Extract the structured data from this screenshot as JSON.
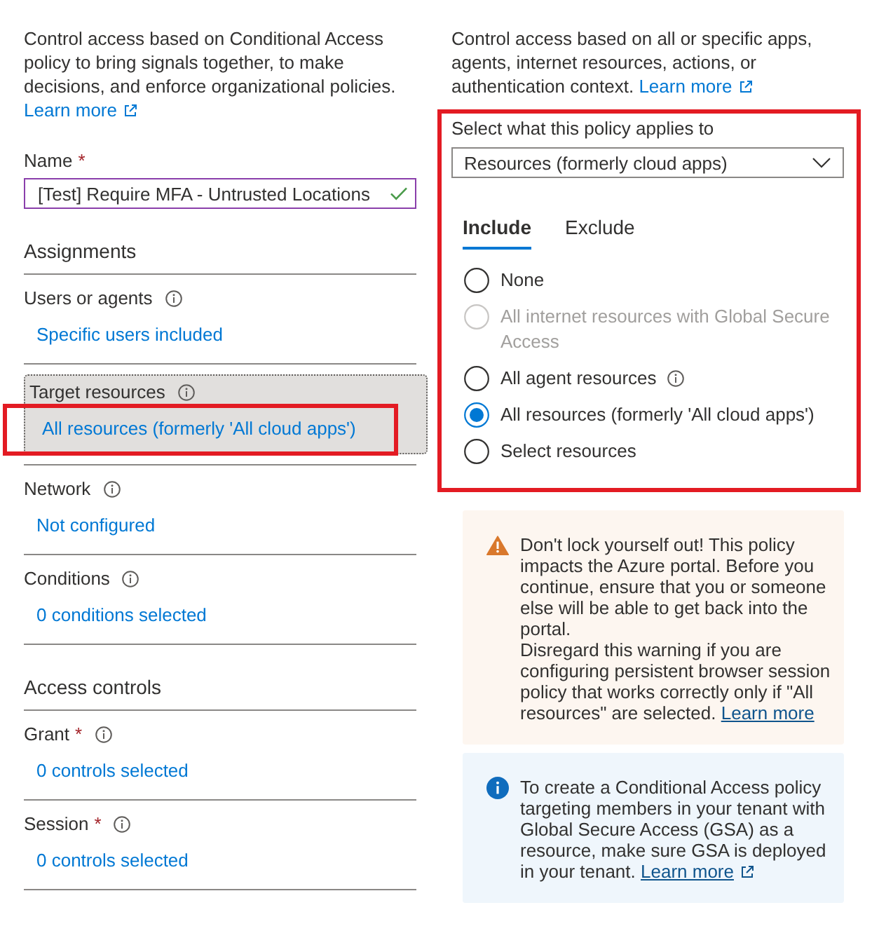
{
  "left": {
    "description": {
      "text": "Control access based on Conditional Access policy to bring signals together, to make decisions, and enforce organizational policies.",
      "link": {
        "text": "Learn more",
        "external": true
      }
    },
    "name_field": {
      "label": "Name",
      "required_mark": "*",
      "value": "[Test] Require MFA - Untrusted Locations",
      "valid": true
    },
    "groups": [
      {
        "heading": "Assignments",
        "items": [
          {
            "label": "Users or agents",
            "info": true,
            "value": "Specific users included",
            "selected": false,
            "highlighted": false
          },
          {
            "label": "Target resources",
            "info": true,
            "value": "All resources (formerly 'All cloud apps')",
            "selected": true,
            "highlighted": true
          },
          {
            "label": "Network",
            "info": true,
            "value": "Not configured",
            "selected": false,
            "highlighted": false
          },
          {
            "label": "Conditions",
            "info": true,
            "value": "0 conditions selected",
            "selected": false,
            "highlighted": false
          }
        ]
      },
      {
        "heading": "Access controls",
        "items": [
          {
            "label": "Grant",
            "required_mark": "*",
            "info": true,
            "value": "0 controls selected",
            "selected": false,
            "highlighted": false
          },
          {
            "label": "Session",
            "required_mark": "*",
            "info": true,
            "value": "0 controls selected",
            "selected": false,
            "highlighted": false
          }
        ]
      }
    ]
  },
  "right": {
    "description": {
      "text": "Control access based on all or specific apps, agents, internet resources, actions, or authentication context.",
      "link": {
        "text": "Learn more",
        "external": true
      }
    },
    "selector": {
      "highlighted": true,
      "label": "Select what this policy applies to",
      "dropdown": {
        "value": "Resources (formerly cloud apps)"
      },
      "tabs": [
        {
          "label": "Include",
          "selected": true
        },
        {
          "label": "Exclude",
          "selected": false
        }
      ],
      "options": [
        {
          "label": "None",
          "selected": false,
          "disabled": false,
          "info": false
        },
        {
          "label": "All internet resources with Global Secure Access",
          "selected": false,
          "disabled": true,
          "info": false
        },
        {
          "label": "All agent resources",
          "selected": false,
          "disabled": false,
          "info": true
        },
        {
          "label": "All resources (formerly 'All cloud apps')",
          "selected": true,
          "disabled": false,
          "info": false
        },
        {
          "label": "Select resources",
          "selected": false,
          "disabled": false,
          "info": false
        }
      ]
    },
    "notices": [
      {
        "kind": "warning",
        "paragraphs": [
          "Don't lock yourself out! This policy impacts the Azure portal. Before you continue, ensure that you or someone else will be able to get back into the portal.",
          "Disregard this warning if you are configuring persistent browser session policy that works correctly only if \"All resources\" are selected."
        ],
        "link": {
          "text": "Learn more",
          "external": false
        }
      },
      {
        "kind": "info",
        "paragraphs": [
          "To create a Conditional Access policy targeting members in your tenant with Global Secure Access (GSA) as a resource, make sure GSA is deployed in your tenant."
        ],
        "link": {
          "text": "Learn more",
          "external": true
        }
      }
    ]
  }
}
